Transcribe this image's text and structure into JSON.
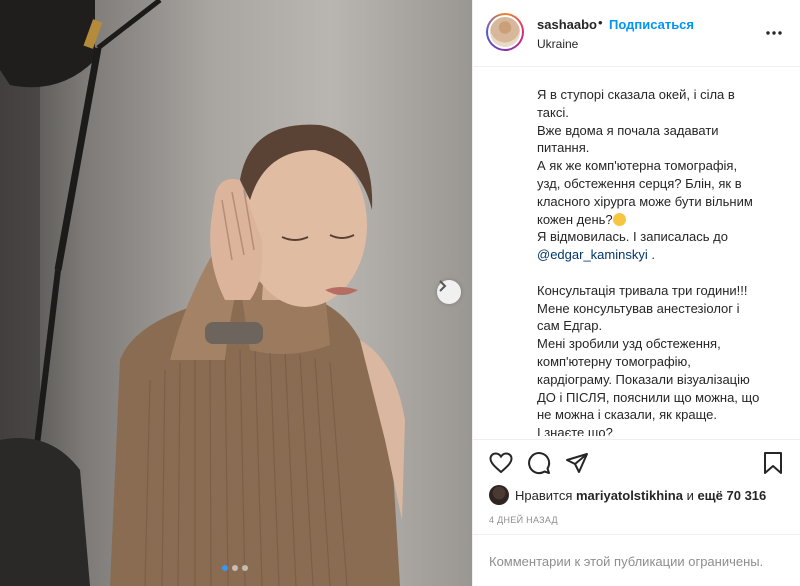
{
  "post": {
    "image_alt": "photo of woman in beige knit top",
    "carousel": {
      "dots": 3,
      "active_index": 0,
      "next_icon": "chevron-right-icon"
    }
  },
  "header": {
    "username": "sashaabo",
    "separator": "•",
    "follow_label": "Подписаться",
    "location": "Ukraine",
    "more_icon": "more-horizontal-icon"
  },
  "caption": {
    "lines": [
      "Я в ступорі сказала окей, і сіла в",
      "таксі.",
      "Вже вдома я почала задавати",
      "питання.",
      "А як же комп'ютерна томографія,",
      "узд, обстеження серця? Блін, як в",
      "класного хірурга може бути вільним",
      "кожен день?",
      "Я відмовилась. І записалась до",
      "",
      "",
      "Консультація тривала три години!!!",
      "Мене консультував анестезіолог і",
      "сам Едгар.",
      "Мені зробили узд обстеження,",
      "комп'ютерну томографію,",
      "кардіограму. Показали візуалізацію",
      "ДО і ПІСЛЯ, пояснили що можна, що",
      "не можна і сказали, як краще.",
      "І знаєте що?"
    ],
    "mention": "@edgar_kaminskyi",
    "mention_suffix": " .",
    "emoji": "grinning-sweat-emoji"
  },
  "actions": {
    "like_icon": "heart-icon",
    "comment_icon": "comment-icon",
    "share_icon": "send-icon",
    "save_icon": "bookmark-icon"
  },
  "likes": {
    "prefix": "Нравится",
    "user": "mariyatolstikhina",
    "middle": "и",
    "rest": "ещё 70 316"
  },
  "date": "4 ДНЕЙ НАЗАД",
  "comments_notice": "Комментарии к этой публикации ограничены.",
  "colors": {
    "accent": "#0095f6",
    "mention": "#00376b",
    "muted": "#8e8e8e",
    "border": "#efefef"
  }
}
